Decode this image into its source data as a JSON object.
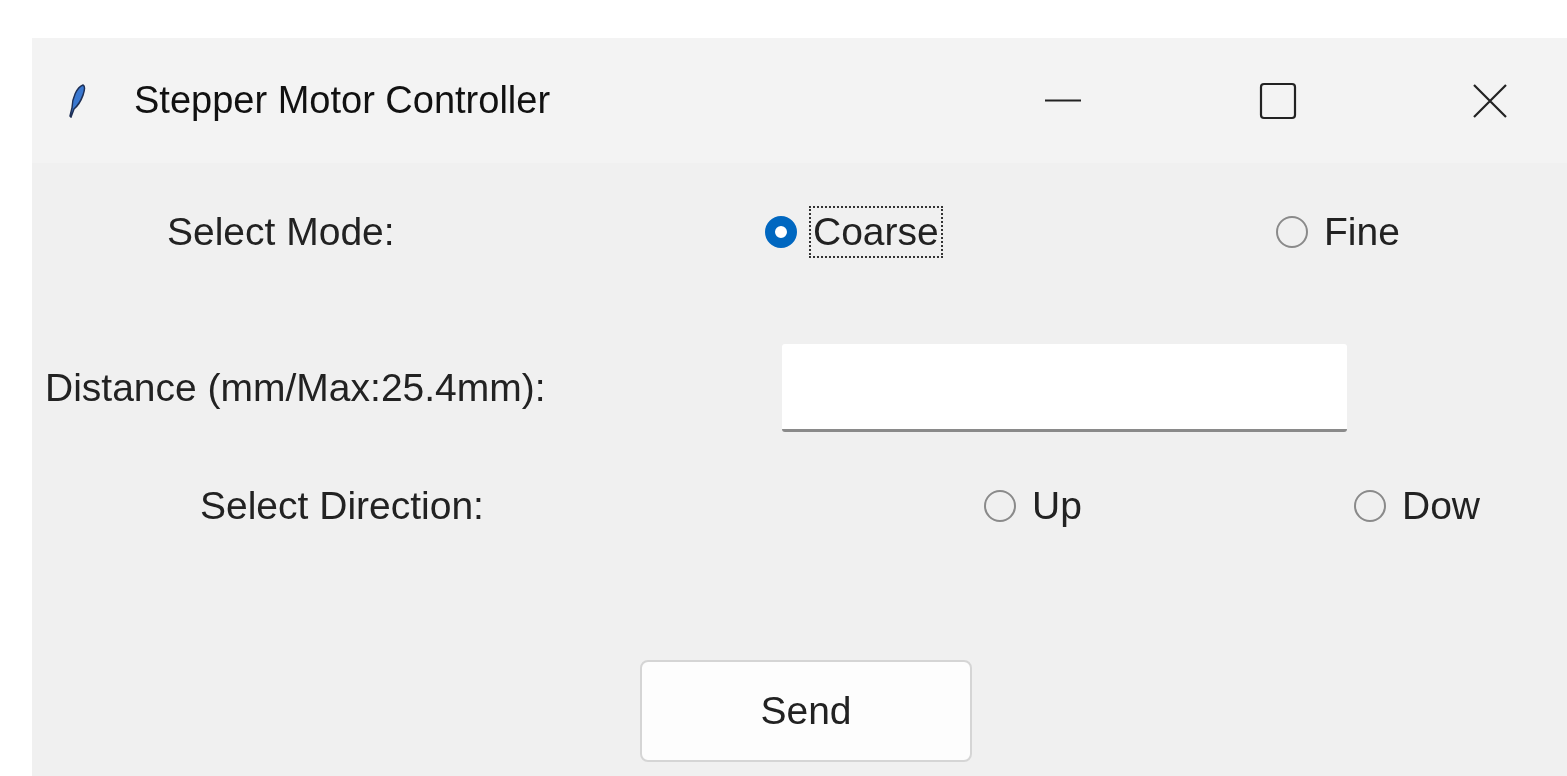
{
  "window": {
    "title": "Stepper Motor Controller"
  },
  "mode": {
    "label": "Select Mode:",
    "options": [
      {
        "label": "Coarse",
        "selected": true,
        "focused": true
      },
      {
        "label": "Fine",
        "selected": false,
        "focused": false
      }
    ]
  },
  "distance": {
    "label": "Distance (mm/Max:25.4mm):"
  },
  "direction": {
    "label": "Select Direction:",
    "options": [
      {
        "label": "Up",
        "selected": false,
        "focused": false
      },
      {
        "label": "Dow",
        "selected": false,
        "focused": false
      }
    ]
  },
  "buttons": [
    "Send"
  ]
}
